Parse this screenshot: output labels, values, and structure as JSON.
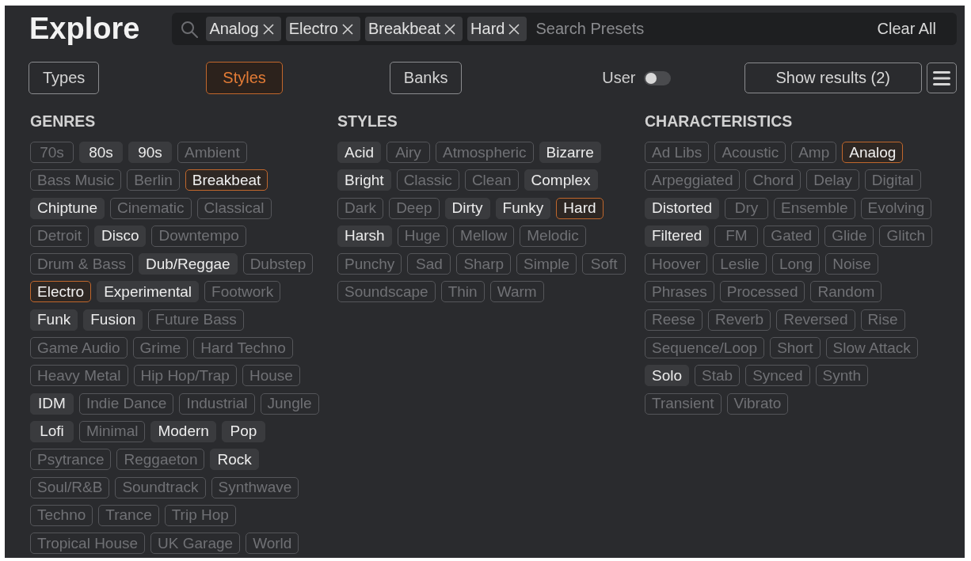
{
  "header": {
    "title": "Explore"
  },
  "search": {
    "chips": [
      "Analog",
      "Electro",
      "Breakbeat",
      "Hard"
    ],
    "placeholder": "Search Presets",
    "clear_label": "Clear All"
  },
  "tabs": [
    {
      "label": "Types",
      "selected": false
    },
    {
      "label": "Styles",
      "selected": true
    },
    {
      "label": "Banks",
      "selected": false
    }
  ],
  "user_toggle": {
    "label": "User",
    "on": false
  },
  "show_results": {
    "label": "Show results (2)"
  },
  "sections": [
    {
      "title": "GENRES",
      "tags": [
        {
          "label": "70s",
          "selected": false,
          "disabled": true
        },
        {
          "label": "80s",
          "selected": false,
          "disabled": false
        },
        {
          "label": "90s",
          "selected": false,
          "disabled": false
        },
        {
          "label": "Ambient",
          "selected": false,
          "disabled": true
        },
        {
          "label": "Bass Music",
          "selected": false,
          "disabled": true
        },
        {
          "label": "Berlin",
          "selected": false,
          "disabled": true
        },
        {
          "label": "Breakbeat",
          "selected": true,
          "disabled": false
        },
        {
          "label": "Chiptune",
          "selected": false,
          "disabled": false
        },
        {
          "label": "Cinematic",
          "selected": false,
          "disabled": true
        },
        {
          "label": "Classical",
          "selected": false,
          "disabled": true
        },
        {
          "label": "Detroit",
          "selected": false,
          "disabled": true
        },
        {
          "label": "Disco",
          "selected": false,
          "disabled": false
        },
        {
          "label": "Downtempo",
          "selected": false,
          "disabled": true
        },
        {
          "label": "Drum & Bass",
          "selected": false,
          "disabled": true
        },
        {
          "label": "Dub/Reggae",
          "selected": false,
          "disabled": false
        },
        {
          "label": "Dubstep",
          "selected": false,
          "disabled": true
        },
        {
          "label": "Electro",
          "selected": true,
          "disabled": false
        },
        {
          "label": "Experimental",
          "selected": false,
          "disabled": false
        },
        {
          "label": "Footwork",
          "selected": false,
          "disabled": true
        },
        {
          "label": "Funk",
          "selected": false,
          "disabled": false
        },
        {
          "label": "Fusion",
          "selected": false,
          "disabled": false
        },
        {
          "label": "Future Bass",
          "selected": false,
          "disabled": true
        },
        {
          "label": "Game Audio",
          "selected": false,
          "disabled": true
        },
        {
          "label": "Grime",
          "selected": false,
          "disabled": true
        },
        {
          "label": "Hard Techno",
          "selected": false,
          "disabled": true
        },
        {
          "label": "Heavy Metal",
          "selected": false,
          "disabled": true
        },
        {
          "label": "Hip Hop/Trap",
          "selected": false,
          "disabled": true
        },
        {
          "label": "House",
          "selected": false,
          "disabled": true
        },
        {
          "label": "IDM",
          "selected": false,
          "disabled": false
        },
        {
          "label": "Indie Dance",
          "selected": false,
          "disabled": true
        },
        {
          "label": "Industrial",
          "selected": false,
          "disabled": true
        },
        {
          "label": "Jungle",
          "selected": false,
          "disabled": true
        },
        {
          "label": "Lofi",
          "selected": false,
          "disabled": false
        },
        {
          "label": "Minimal",
          "selected": false,
          "disabled": true
        },
        {
          "label": "Modern",
          "selected": false,
          "disabled": false
        },
        {
          "label": "Pop",
          "selected": false,
          "disabled": false
        },
        {
          "label": "Psytrance",
          "selected": false,
          "disabled": true
        },
        {
          "label": "Reggaeton",
          "selected": false,
          "disabled": true
        },
        {
          "label": "Rock",
          "selected": false,
          "disabled": false
        },
        {
          "label": "Soul/R&B",
          "selected": false,
          "disabled": true
        },
        {
          "label": "Soundtrack",
          "selected": false,
          "disabled": true
        },
        {
          "label": "Synthwave",
          "selected": false,
          "disabled": true
        },
        {
          "label": "Techno",
          "selected": false,
          "disabled": true
        },
        {
          "label": "Trance",
          "selected": false,
          "disabled": true
        },
        {
          "label": "Trip Hop",
          "selected": false,
          "disabled": true
        },
        {
          "label": "Tropical House",
          "selected": false,
          "disabled": true
        },
        {
          "label": "UK Garage",
          "selected": false,
          "disabled": true
        },
        {
          "label": "World",
          "selected": false,
          "disabled": true
        }
      ]
    },
    {
      "title": "STYLES",
      "tags": [
        {
          "label": "Acid",
          "selected": false,
          "disabled": false
        },
        {
          "label": "Airy",
          "selected": false,
          "disabled": true
        },
        {
          "label": "Atmospheric",
          "selected": false,
          "disabled": true
        },
        {
          "label": "Bizarre",
          "selected": false,
          "disabled": false
        },
        {
          "label": "Bright",
          "selected": false,
          "disabled": false
        },
        {
          "label": "Classic",
          "selected": false,
          "disabled": true
        },
        {
          "label": "Clean",
          "selected": false,
          "disabled": true
        },
        {
          "label": "Complex",
          "selected": false,
          "disabled": false
        },
        {
          "label": "Dark",
          "selected": false,
          "disabled": true
        },
        {
          "label": "Deep",
          "selected": false,
          "disabled": true
        },
        {
          "label": "Dirty",
          "selected": false,
          "disabled": false
        },
        {
          "label": "Funky",
          "selected": false,
          "disabled": false
        },
        {
          "label": "Hard",
          "selected": true,
          "disabled": false
        },
        {
          "label": "Harsh",
          "selected": false,
          "disabled": false
        },
        {
          "label": "Huge",
          "selected": false,
          "disabled": true
        },
        {
          "label": "Mellow",
          "selected": false,
          "disabled": true
        },
        {
          "label": "Melodic",
          "selected": false,
          "disabled": true
        },
        {
          "label": "Punchy",
          "selected": false,
          "disabled": true
        },
        {
          "label": "Sad",
          "selected": false,
          "disabled": true
        },
        {
          "label": "Sharp",
          "selected": false,
          "disabled": true
        },
        {
          "label": "Simple",
          "selected": false,
          "disabled": true
        },
        {
          "label": "Soft",
          "selected": false,
          "disabled": true
        },
        {
          "label": "Soundscape",
          "selected": false,
          "disabled": true
        },
        {
          "label": "Thin",
          "selected": false,
          "disabled": true
        },
        {
          "label": "Warm",
          "selected": false,
          "disabled": true
        }
      ]
    },
    {
      "title": "CHARACTERISTICS",
      "tags": [
        {
          "label": "Ad Libs",
          "selected": false,
          "disabled": true
        },
        {
          "label": "Acoustic",
          "selected": false,
          "disabled": true
        },
        {
          "label": "Amp",
          "selected": false,
          "disabled": true
        },
        {
          "label": "Analog",
          "selected": true,
          "disabled": false
        },
        {
          "label": "Arpeggiated",
          "selected": false,
          "disabled": true
        },
        {
          "label": "Chord",
          "selected": false,
          "disabled": true
        },
        {
          "label": "Delay",
          "selected": false,
          "disabled": true
        },
        {
          "label": "Digital",
          "selected": false,
          "disabled": true
        },
        {
          "label": "Distorted",
          "selected": false,
          "disabled": false
        },
        {
          "label": "Dry",
          "selected": false,
          "disabled": true
        },
        {
          "label": "Ensemble",
          "selected": false,
          "disabled": true
        },
        {
          "label": "Evolving",
          "selected": false,
          "disabled": true
        },
        {
          "label": "Filtered",
          "selected": false,
          "disabled": false
        },
        {
          "label": "FM",
          "selected": false,
          "disabled": true
        },
        {
          "label": "Gated",
          "selected": false,
          "disabled": true
        },
        {
          "label": "Glide",
          "selected": false,
          "disabled": true
        },
        {
          "label": "Glitch",
          "selected": false,
          "disabled": true
        },
        {
          "label": "Hoover",
          "selected": false,
          "disabled": true
        },
        {
          "label": "Leslie",
          "selected": false,
          "disabled": true
        },
        {
          "label": "Long",
          "selected": false,
          "disabled": true
        },
        {
          "label": "Noise",
          "selected": false,
          "disabled": true
        },
        {
          "label": "Phrases",
          "selected": false,
          "disabled": true
        },
        {
          "label": "Processed",
          "selected": false,
          "disabled": true
        },
        {
          "label": "Random",
          "selected": false,
          "disabled": true
        },
        {
          "label": "Reese",
          "selected": false,
          "disabled": true
        },
        {
          "label": "Reverb",
          "selected": false,
          "disabled": true
        },
        {
          "label": "Reversed",
          "selected": false,
          "disabled": true
        },
        {
          "label": "Rise",
          "selected": false,
          "disabled": true
        },
        {
          "label": "Sequence/Loop",
          "selected": false,
          "disabled": true
        },
        {
          "label": "Short",
          "selected": false,
          "disabled": true
        },
        {
          "label": "Slow Attack",
          "selected": false,
          "disabled": true
        },
        {
          "label": "Solo",
          "selected": false,
          "disabled": false
        },
        {
          "label": "Stab",
          "selected": false,
          "disabled": true
        },
        {
          "label": "Synced",
          "selected": false,
          "disabled": true
        },
        {
          "label": "Synth",
          "selected": false,
          "disabled": true
        },
        {
          "label": "Transient",
          "selected": false,
          "disabled": true
        },
        {
          "label": "Vibrato",
          "selected": false,
          "disabled": true
        }
      ]
    }
  ]
}
